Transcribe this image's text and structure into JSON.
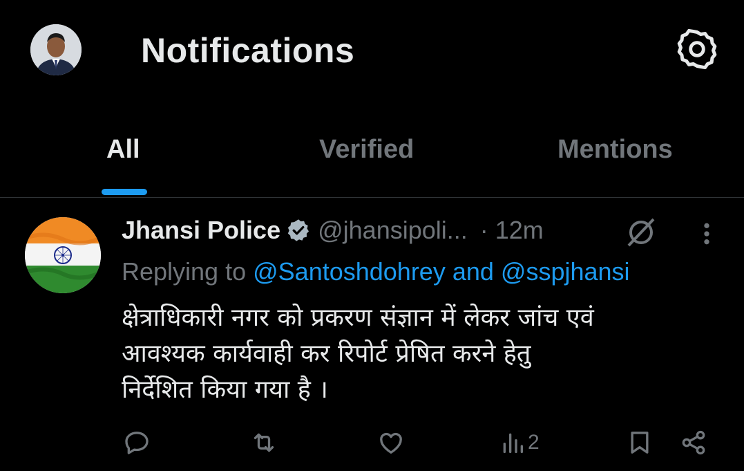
{
  "header": {
    "title": "Notifications",
    "profile_avatar": "profile-avatar",
    "settings_icon": "gear-icon"
  },
  "tabs": [
    {
      "label": "All",
      "active": true
    },
    {
      "label": "Verified",
      "active": false
    },
    {
      "label": "Mentions",
      "active": false
    }
  ],
  "tweet": {
    "author_name": "Jhansi Police",
    "verified_icon": "verified-badge-icon",
    "handle": "@jhansipoli...",
    "time": "· 12m",
    "replying_prefix": "Replying to ",
    "replying_users": "@Santoshdohrey and @sspjhansi",
    "body_lines": [
      "क्षेत्राधिकारी नगर को प्रकरण संज्ञान में लेकर जांच एवं",
      "आवश्यक कार्यवाही कर रिपोर्ट प्रेषित करने हेतु",
      "निर्देशित किया गया है ।"
    ],
    "views_count": "2"
  },
  "colors": {
    "background": "#000000",
    "text_primary": "#e7e9ea",
    "text_secondary": "#71767b",
    "accent": "#1d9bf0"
  }
}
